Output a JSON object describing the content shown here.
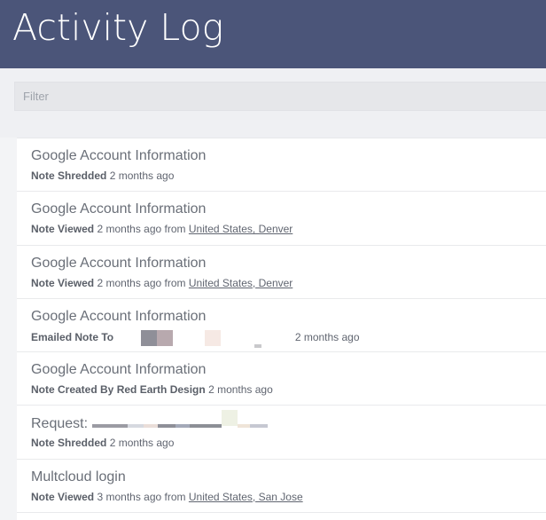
{
  "header": {
    "title": "Activity Log"
  },
  "filter": {
    "placeholder": "Filter"
  },
  "entries": [
    {
      "title": "Google Account Information",
      "action": "Note Shredded",
      "time": "2 months ago"
    },
    {
      "title": "Google Account Information",
      "action": "Note Viewed",
      "time": "2 months ago",
      "from_label": "from",
      "location": "United States, Denver"
    },
    {
      "title": "Google Account Information",
      "action": "Note Viewed",
      "time": "2 months ago",
      "from_label": "from",
      "location": "United States, Denver"
    },
    {
      "title": "Google Account Information",
      "action": "Emailed Note To",
      "time": "2 months ago"
    },
    {
      "title": "Google Account Information",
      "action": "Note Created By Red Earth Design",
      "time": "2 months ago"
    },
    {
      "title": "Request:",
      "action": "Note Shredded",
      "time": "2 months ago"
    },
    {
      "title": "Multcloud login",
      "action": "Note Viewed",
      "time": "3 months ago",
      "from_label": "from",
      "location": "United States, San Jose"
    }
  ],
  "colors": {
    "header_bg": "#4b5579",
    "page_bg": "#eff0f3",
    "row_bg": "#ffffff"
  }
}
